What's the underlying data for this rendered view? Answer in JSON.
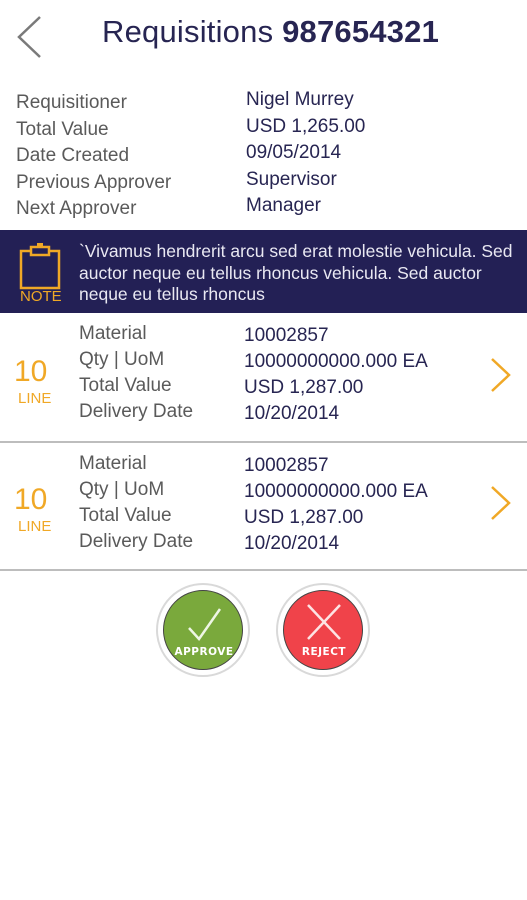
{
  "header": {
    "back_icon": "chevron-left-icon",
    "title_prefix": "Requisitions",
    "title_number": "987654321"
  },
  "summary": [
    {
      "label": "Requisitioner",
      "value": "Nigel Murrey"
    },
    {
      "label": "Total Value",
      "value": "USD 1,265.00"
    },
    {
      "label": "Date Created",
      "value": "09/05/2014"
    },
    {
      "label": "Previous Approver",
      "value": "Supervisor"
    },
    {
      "label": "Next Approver",
      "value": "Manager"
    }
  ],
  "note": {
    "icon": "clipboard-icon",
    "label": "NOTE",
    "text": "`Vivamus hendrerit arcu sed erat molestie vehicula. Sed auctor neque eu tellus rhoncus vehicula. Sed auctor neque eu tellus rhoncus"
  },
  "lines": [
    {
      "number": "10",
      "tag": "LINE",
      "fields": [
        {
          "label": "Material",
          "value": "10002857"
        },
        {
          "label": "Qty | UoM",
          "value": "10000000000.000 EA"
        },
        {
          "label": "Total Value",
          "value": "USD 1,287.00"
        },
        {
          "label": "Delivery Date",
          "value": "10/20/2014"
        }
      ]
    },
    {
      "number": "10",
      "tag": "LINE",
      "fields": [
        {
          "label": "Material",
          "value": "10002857"
        },
        {
          "label": "Qty | UoM",
          "value": "10000000000.000 EA"
        },
        {
          "label": "Total Value",
          "value": "USD 1,287.00"
        },
        {
          "label": "Delivery Date",
          "value": "10/20/2014"
        }
      ]
    }
  ],
  "actions": {
    "approve_label": "APPROVE",
    "reject_label": "REJECT"
  },
  "colors": {
    "primary_navy": "#232055",
    "accent_orange": "#f0a826",
    "approve_green": "#7aa93c",
    "reject_red": "#f0434a"
  }
}
